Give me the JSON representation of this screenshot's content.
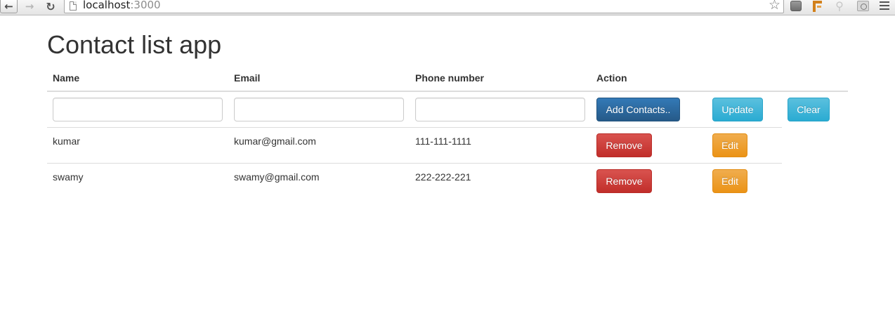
{
  "browser": {
    "url_host": "localhost",
    "url_port": ":3000"
  },
  "page": {
    "title": "Contact list app"
  },
  "table": {
    "headers": {
      "name": "Name",
      "email": "Email",
      "phone": "Phone number",
      "action": "Action"
    },
    "form": {
      "name_value": "",
      "email_value": "",
      "phone_value": "",
      "add_label": "Add Contacts..",
      "update_label": "Update",
      "clear_label": "Clear"
    },
    "rows": [
      {
        "name": "kumar",
        "email": "kumar@gmail.com",
        "phone": "111-111-1111",
        "remove_label": "Remove",
        "edit_label": "Edit"
      },
      {
        "name": "swamy",
        "email": "swamy@gmail.com",
        "phone": "222-222-221",
        "remove_label": "Remove",
        "edit_label": "Edit"
      }
    ]
  },
  "colors": {
    "primary": "#286090",
    "info": "#46b8da",
    "danger": "#d9534f",
    "warning": "#f0ad4e"
  },
  "icons": {
    "back": "back-arrow-icon",
    "forward": "forward-arrow-icon",
    "reload": "reload-icon",
    "page": "page-icon",
    "bookmark": "star-icon",
    "menu": "hamburger-menu-icon"
  }
}
